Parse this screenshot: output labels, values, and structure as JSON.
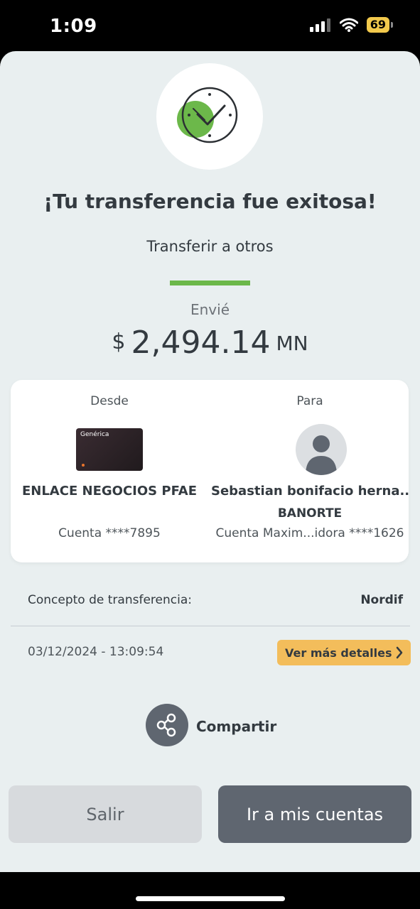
{
  "status_bar": {
    "time": "1:09",
    "battery": "69"
  },
  "header": {
    "title": "¡Tu transferencia fue exitosa!",
    "subtitle": "Transferir a otros",
    "sent_label": "Envié",
    "amount_symbol": "$",
    "amount": "2,494.14",
    "currency": "MN"
  },
  "transfer_card": {
    "from": {
      "heading": "Desde",
      "card_label": "Genérica",
      "name": "ENLACE NEGOCIOS PFAE",
      "account": "Cuenta ****7895"
    },
    "to": {
      "heading": "Para",
      "name": "Sebastian bonifacio herna...",
      "bank": "BANORTE",
      "account": "Cuenta Maxim...idora ****1626"
    }
  },
  "details": {
    "concept_label": "Concepto de transferencia:",
    "concept_value": "Nordif",
    "datetime": "03/12/2024 - 13:09:54",
    "more_details": "Ver más detalles"
  },
  "actions": {
    "share": "Compartir",
    "exit": "Salir",
    "go_accounts": "Ir a mis cuentas"
  },
  "colors": {
    "accent_green": "#6cb84a",
    "details_button": "#f3bd5b",
    "primary_button": "#5f6670",
    "background": "#e9eff0"
  },
  "icons": [
    "signal-icon",
    "wifi-icon",
    "battery-icon",
    "success-check-icon",
    "avatar-icon",
    "chevron-right-icon",
    "share-icon"
  ]
}
